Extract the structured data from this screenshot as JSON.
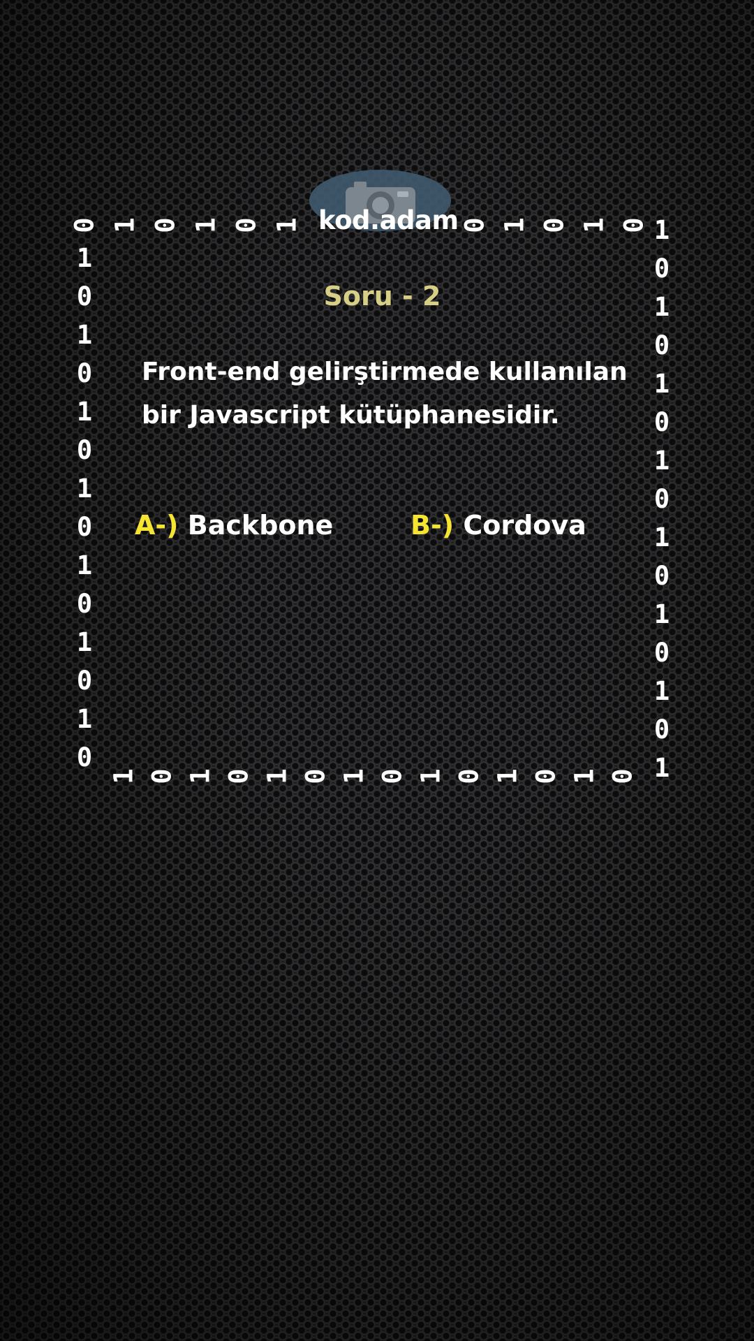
{
  "brand": {
    "name": "kod.adam",
    "icon": "camera-icon"
  },
  "question": {
    "number_label": "Soru - 2",
    "text": "Front-end gelirştirmede kullanılan bir Javascript kütüphanesidir."
  },
  "options": [
    {
      "prefix": "A-)",
      "label": "Backbone"
    },
    {
      "prefix": "B-)",
      "label": "Cordova"
    }
  ],
  "binary_border": {
    "top_left": [
      "0",
      "1",
      "0",
      "1",
      "0",
      "1"
    ],
    "top_right": [
      "0",
      "1",
      "0",
      "1",
      "0"
    ],
    "left": [
      "1",
      "0",
      "1",
      "0",
      "1",
      "0",
      "1",
      "0",
      "1",
      "0",
      "1",
      "0",
      "1",
      "0"
    ],
    "right": [
      "1",
      "0",
      "1",
      "0",
      "1",
      "0",
      "1",
      "0",
      "1",
      "0",
      "1",
      "0",
      "1",
      "0",
      "1"
    ],
    "bottom": [
      "1",
      "0",
      "1",
      "0",
      "1",
      "0",
      "1",
      "0",
      "1",
      "0",
      "1",
      "0",
      "1",
      "0"
    ]
  },
  "colors": {
    "question_number": "#d8cf86",
    "option_prefix": "#f5e531",
    "text": "#ffffff",
    "logo_badge": "#3f5a6e"
  }
}
